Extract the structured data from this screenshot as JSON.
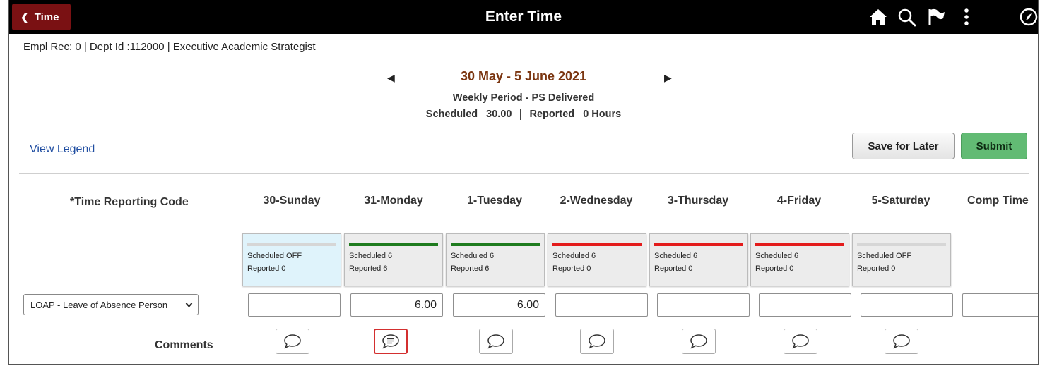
{
  "header": {
    "back_label": "Time",
    "title": "Enter Time",
    "icons": [
      "home-icon",
      "search-icon",
      "flag-icon",
      "more-vert-icon",
      "navbar-compass-icon"
    ]
  },
  "employee_info": "Empl Rec: 0 | Dept Id :112000 | Executive Academic Strategist",
  "period": {
    "range": "30 May - 5 June 2021",
    "type": "Weekly Period - PS Delivered",
    "scheduled_label": "Scheduled",
    "scheduled_value": "30.00",
    "reported_label": "Reported",
    "reported_value": "0 Hours"
  },
  "actions": {
    "view_legend": "View Legend",
    "save_for_later": "Save for Later",
    "submit": "Submit"
  },
  "grid": {
    "trc_header": "*Time Reporting Code",
    "comp_time_header": "Comp Time",
    "days": [
      {
        "label": "30-Sunday",
        "scheduled": "Scheduled OFF",
        "reported": "Reported  0",
        "status_color": "#d6d6d6",
        "hours": ""
      },
      {
        "label": "31-Monday",
        "scheduled": "Scheduled 6",
        "reported": "Reported  6",
        "status_color": "#1e7b1e",
        "hours": "6.00"
      },
      {
        "label": "1-Tuesday",
        "scheduled": "Scheduled 6",
        "reported": "Reported  6",
        "status_color": "#1e7b1e",
        "hours": "6.00"
      },
      {
        "label": "2-Wednesday",
        "scheduled": "Scheduled 6",
        "reported": "Reported  0",
        "status_color": "#e31b1b",
        "hours": ""
      },
      {
        "label": "3-Thursday",
        "scheduled": "Scheduled 6",
        "reported": "Reported  0",
        "status_color": "#e31b1b",
        "hours": ""
      },
      {
        "label": "4-Friday",
        "scheduled": "Scheduled 6",
        "reported": "Reported  0",
        "status_color": "#e31b1b",
        "hours": ""
      },
      {
        "label": "5-Saturday",
        "scheduled": "Scheduled OFF",
        "reported": "Reported  0",
        "status_color": "#d6d6d6",
        "hours": ""
      }
    ],
    "comp_time_hours": "",
    "trc_value": "LOAP - Leave of Absence Person",
    "comments_label": "Comments"
  }
}
